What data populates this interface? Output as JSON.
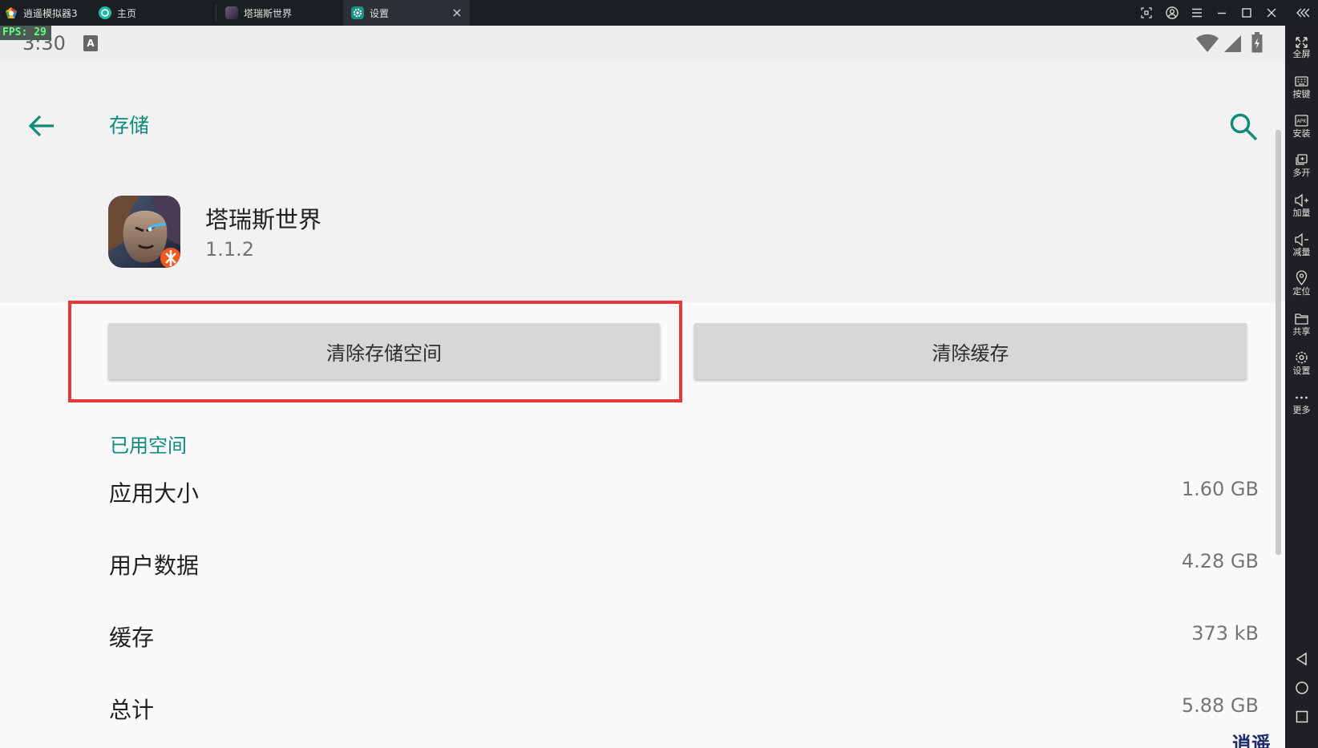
{
  "titlebar": {
    "tabs": [
      {
        "label": "逍遥模拟器3",
        "icon": "xiaoyao-logo-icon"
      },
      {
        "label": "主页",
        "icon": "home-tab-icon"
      },
      {
        "label": "塔瑞斯世界",
        "icon": "game-tab-icon"
      },
      {
        "label": "设置",
        "icon": "settings-tab-icon"
      }
    ],
    "close_tab_glyph": "×",
    "window_controls": [
      "screenshot-icon",
      "account-icon",
      "menu-icon",
      "minimize-icon",
      "maximize-icon",
      "close-icon",
      "collapse-sidebar-icon"
    ]
  },
  "statusbar": {
    "fps": "FPS: 29",
    "time": "3:30",
    "notification_glyph": "A"
  },
  "header": {
    "title": "存储"
  },
  "app": {
    "name": "塔瑞斯世界",
    "version": "1.1.2"
  },
  "buttons": {
    "clear_storage": "清除存储空间",
    "clear_cache": "清除缓存"
  },
  "section": {
    "label": "已用空间"
  },
  "rows": [
    {
      "label": "应用大小",
      "value": "1.60 GB"
    },
    {
      "label": "用户数据",
      "value": "4.28 GB"
    },
    {
      "label": "缓存",
      "value": "373 kB"
    },
    {
      "label": "总计",
      "value": "5.88 GB"
    }
  ],
  "sidebar": {
    "tools": [
      {
        "label": "全屏",
        "icon": "fullscreen-icon"
      },
      {
        "label": "按键",
        "icon": "keyboard-icon"
      },
      {
        "label": "安装",
        "icon": "apk-install-icon"
      },
      {
        "label": "多开",
        "icon": "multi-instance-icon"
      },
      {
        "label": "加量",
        "icon": "volume-up-icon"
      },
      {
        "label": "减量",
        "icon": "volume-down-icon"
      },
      {
        "label": "定位",
        "icon": "location-icon"
      },
      {
        "label": "共享",
        "icon": "shared-folder-icon"
      },
      {
        "label": "设置",
        "icon": "settings-icon"
      },
      {
        "label": "更多",
        "icon": "more-icon"
      }
    ],
    "nav": [
      "nav-back-icon",
      "nav-home-icon",
      "nav-recents-icon"
    ]
  },
  "watermark": {
    "text": "逍遥安卓"
  },
  "colors": {
    "accent": "#0f8a7c",
    "highlight": "#e8363a",
    "button": "#d7d7d7"
  }
}
